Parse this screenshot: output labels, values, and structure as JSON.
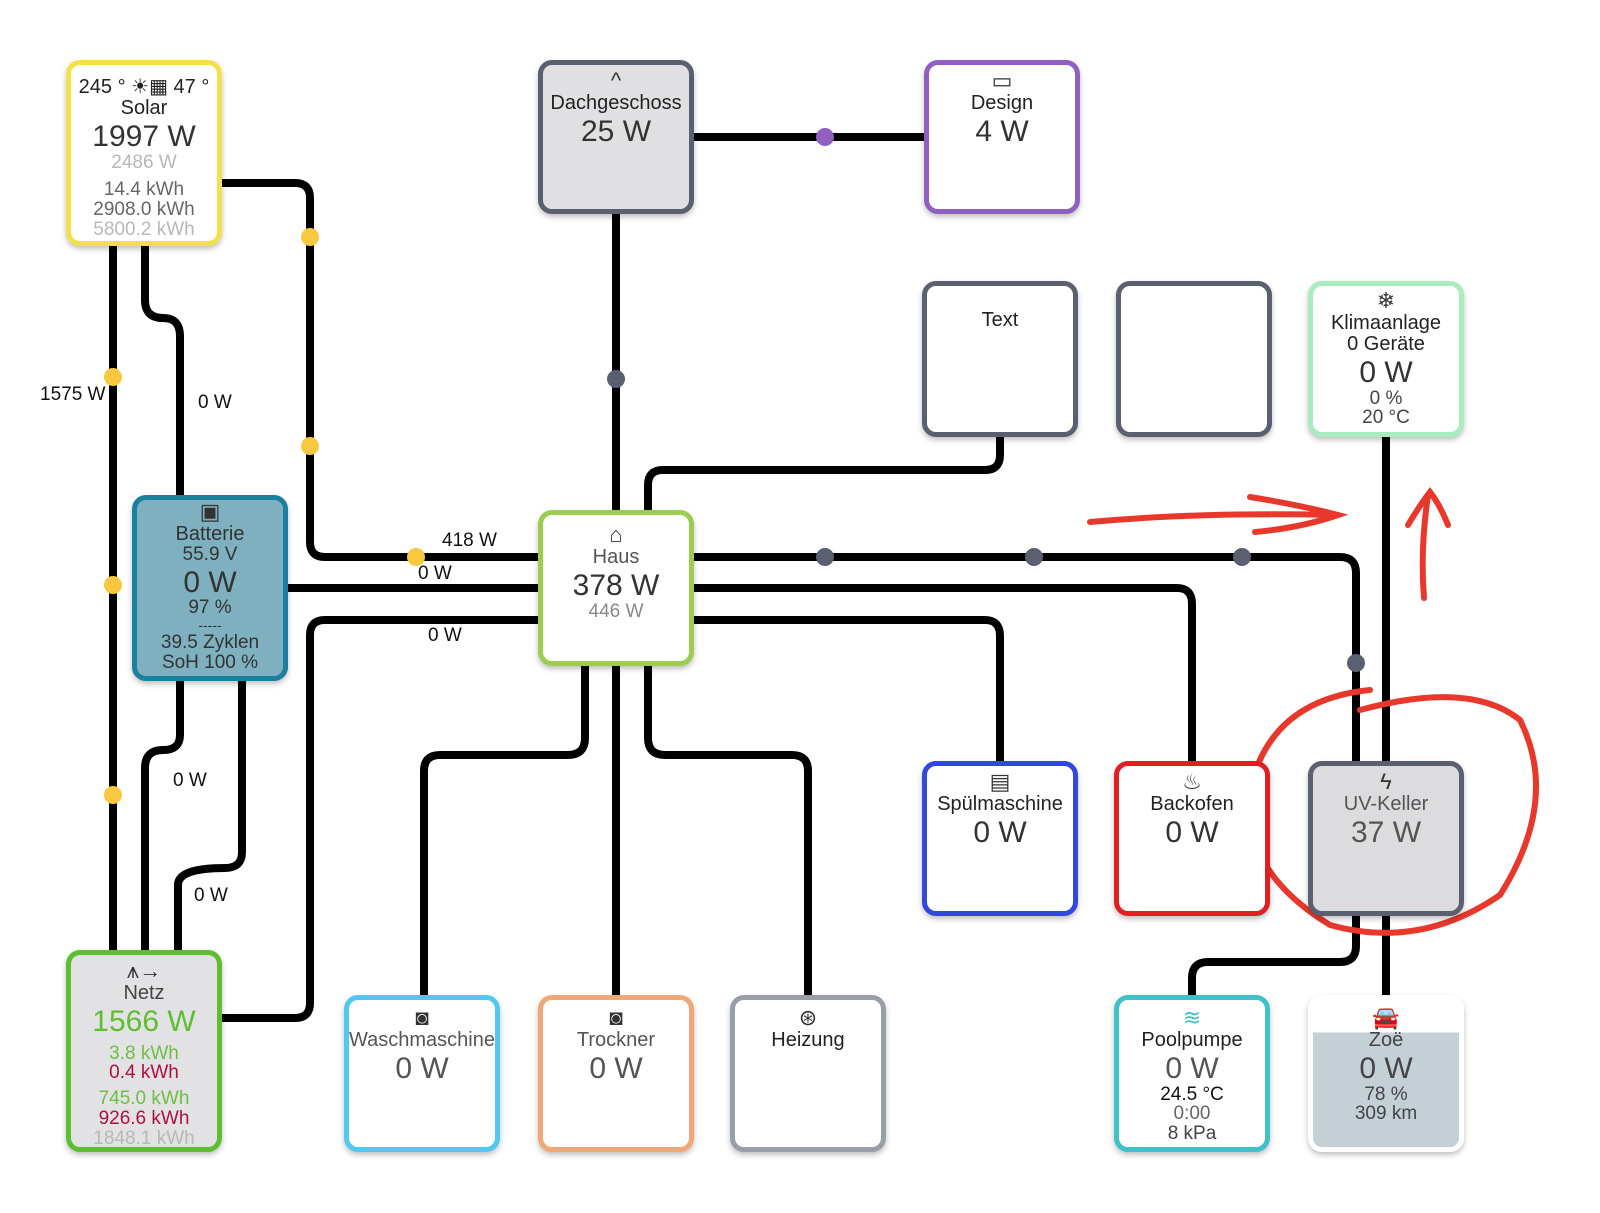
{
  "solar": {
    "azimuth": "245 °",
    "tilt": "47 °",
    "name": "Solar",
    "power": "1997 W",
    "peak": "2486 W",
    "today": "14.4 kWh",
    "total": "2908.0 kWh",
    "total2": "5800.2 kWh",
    "color": "#f5e04a",
    "icon": "solar-panel-icon"
  },
  "dachgeschoss": {
    "name": "Dachgeschoss",
    "power": "25 W",
    "icon": "roof-icon"
  },
  "design": {
    "name": "Design",
    "power": "4 W",
    "color": "#9060c0",
    "icon": "monitor-icon"
  },
  "text_box": {
    "name": "Text"
  },
  "klima": {
    "name": "Klimaanlage",
    "devices": "0 Geräte",
    "power": "0 W",
    "percent": "0 %",
    "temp": "20 °C",
    "color": "#a8ecc0",
    "icon": "air-conditioner-icon"
  },
  "batterie": {
    "name": "Batterie",
    "voltage": "55.9 V",
    "power": "0 W",
    "soc": "97 %",
    "sep": "-----",
    "cycles": "39.5 Zyklen",
    "soh": "SoH 100 %",
    "color": "#1a7fa0",
    "icon": "battery-icon"
  },
  "haus": {
    "name": "Haus",
    "power": "378 W",
    "secondary": "446 W",
    "color": "#9ccc50",
    "icon": "house-icon"
  },
  "spuel": {
    "name": "Spülmaschine",
    "power": "0 W",
    "color": "#3048e0",
    "icon": "dishwasher-icon"
  },
  "backofen": {
    "name": "Backofen",
    "power": "0 W",
    "color": "#e02020",
    "icon": "oven-icon"
  },
  "uvkeller": {
    "name": "UV-Keller",
    "power": "37 W",
    "icon": "lightning-icon"
  },
  "netz": {
    "name": "Netz",
    "power": "1566 W",
    "import_today": "3.8 kWh",
    "export_today": "0.4 kWh",
    "import_total": "745.0 kWh",
    "export_total": "926.6 kWh",
    "total": "1848.1 kWh",
    "color": "#5cbf30",
    "icon": "transmission-tower-icon"
  },
  "wasch": {
    "name": "Waschmaschine",
    "power": "0 W",
    "color": "#50c8f0",
    "icon": "washing-machine-icon"
  },
  "trockner": {
    "name": "Trockner",
    "power": "0 W",
    "color": "#f0a878",
    "icon": "tumble-dryer-icon"
  },
  "heizung": {
    "name": "Heizung",
    "icon": "heater-icon"
  },
  "pool": {
    "name": "Poolpumpe",
    "power": "0 W",
    "temp": "24.5 °C",
    "time": "0:00",
    "pressure": "8 kPa",
    "color": "#40c0c8",
    "icon": "pool-icon"
  },
  "zoe": {
    "name": "Zoë",
    "power": "0 W",
    "soc": "78 %",
    "range": "309 km",
    "icon": "car-icon"
  },
  "flows": {
    "solar_netz": "1575 W",
    "solar_batt": "0 W",
    "solar_haus": "418 W",
    "batt_haus": "0 W",
    "netz_haus": "0 W",
    "batt_netz_1": "0 W",
    "batt_netz_2": "0 W"
  },
  "annotation_color": "#e8382c"
}
